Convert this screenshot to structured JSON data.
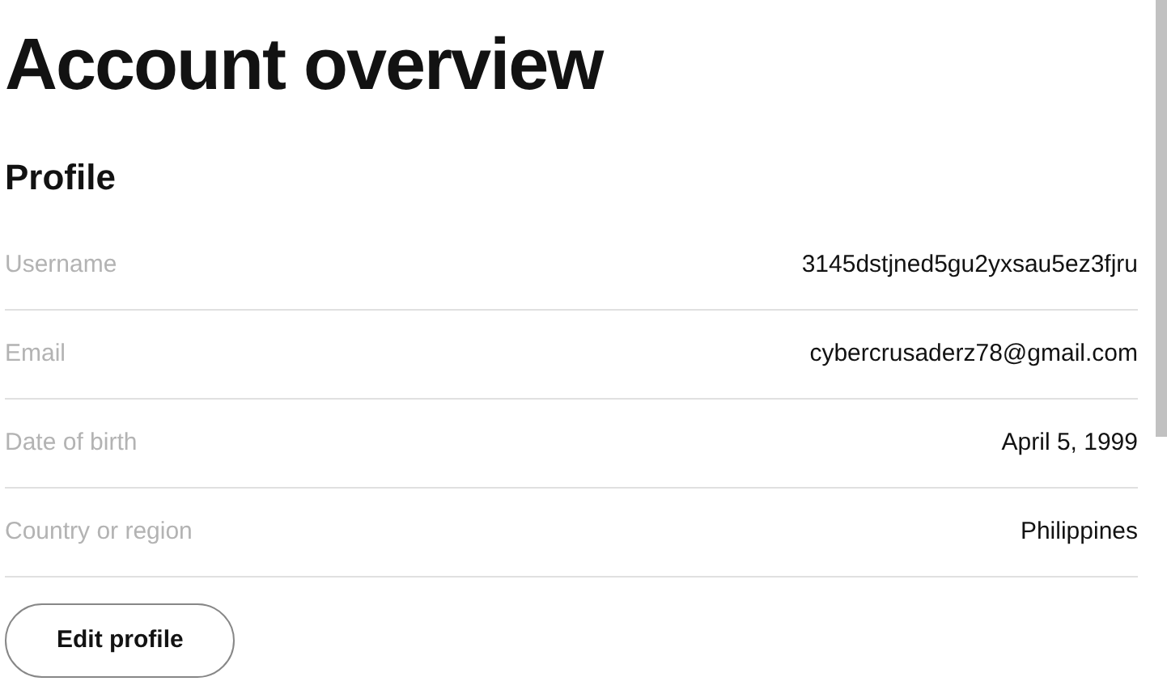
{
  "title": "Account overview",
  "section": {
    "heading": "Profile",
    "rows": [
      {
        "label": "Username",
        "value": "3145dstjned5gu2yxsau5ez3fjru"
      },
      {
        "label": "Email",
        "value": "cybercrusaderz78@gmail.com"
      },
      {
        "label": "Date of birth",
        "value": "April 5, 1999"
      },
      {
        "label": "Country or region",
        "value": "Philippines"
      }
    ],
    "button": "Edit profile"
  }
}
